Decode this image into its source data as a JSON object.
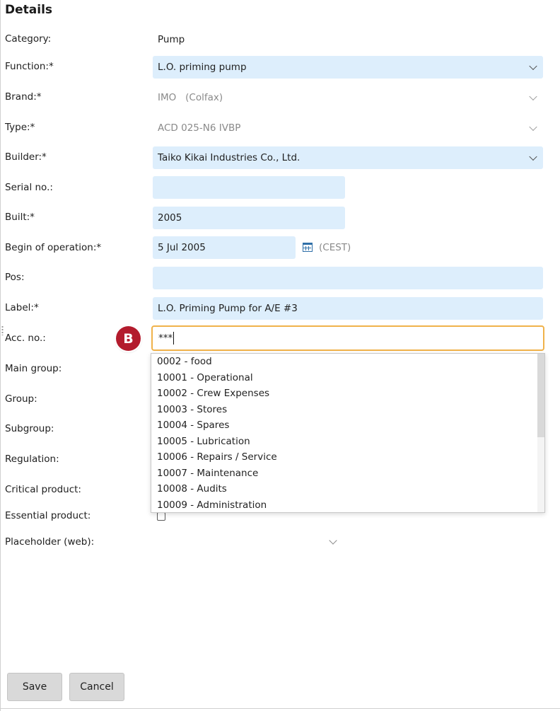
{
  "section_title": "Details",
  "fields": {
    "category": {
      "label": "Category:",
      "value": "Pump"
    },
    "function": {
      "label": "Function:*",
      "value": "L.O. priming pump"
    },
    "brand": {
      "label": "Brand:*",
      "value": "IMO   (Colfax)"
    },
    "type": {
      "label": "Type:*",
      "value": "ACD 025-N6 IVBP"
    },
    "builder": {
      "label": "Builder:*",
      "value": "Taiko Kikai Industries Co., Ltd."
    },
    "serial_no": {
      "label": "Serial no.:",
      "value": ""
    },
    "built": {
      "label": "Built:*",
      "value": "2005"
    },
    "begin_operation": {
      "label": "Begin of operation:*",
      "value": "5 Jul 2005",
      "timezone": "(CEST)"
    },
    "pos": {
      "label": "Pos:",
      "value": ""
    },
    "label": {
      "label": "Label:*",
      "value": "L.O. Priming Pump for A/E #3"
    },
    "acc_no": {
      "label": "Acc. no.:",
      "value": "***"
    },
    "main_group": {
      "label": "Main group:"
    },
    "group": {
      "label": "Group:"
    },
    "subgroup": {
      "label": "Subgroup:"
    },
    "regulation": {
      "label": "Regulation:"
    },
    "critical_product": {
      "label": "Critical product:"
    },
    "essential_product": {
      "label": "Essential product:"
    },
    "placeholder_web": {
      "label": "Placeholder (web):"
    }
  },
  "badge": "B",
  "acc_options": [
    "0002 - food",
    "10001 - Operational",
    "10002 - Crew Expenses",
    "10003 - Stores",
    "10004 - Spares",
    "10005 - Lubrication",
    "10006 - Repairs / Service",
    "10007 - Maintenance",
    "10008 - Audits",
    "10009 - Administration"
  ],
  "buttons": {
    "save": "Save",
    "cancel": "Cancel"
  },
  "icons": {
    "dropdown": "chevron-down-icon",
    "calendar": "calendar-icon"
  },
  "colors": {
    "field_bg": "#ddeefc",
    "focus_border": "#f0b24a",
    "badge_bg": "#b31b2d"
  }
}
